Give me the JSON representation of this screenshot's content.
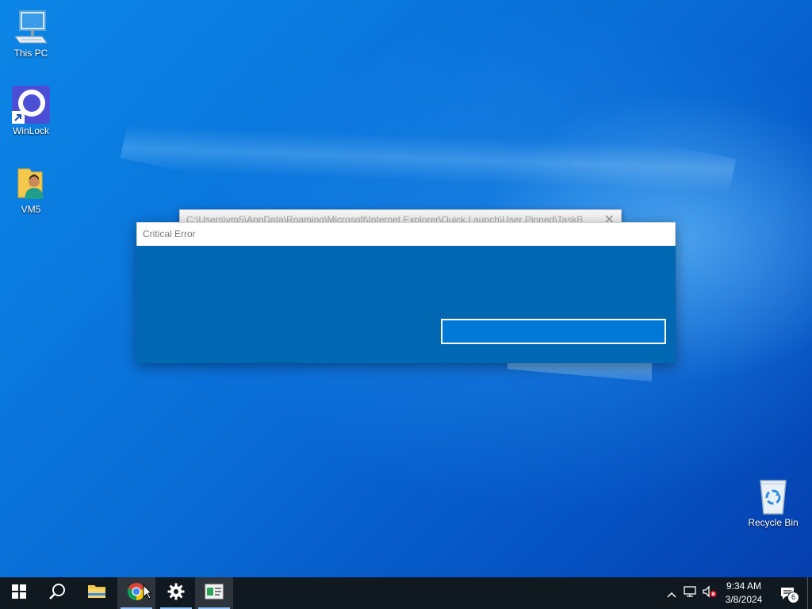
{
  "desktop": {
    "icons": [
      {
        "label": "This PC",
        "icon": "computer-icon"
      },
      {
        "label": "WinLock",
        "icon": "winlock-icon"
      },
      {
        "label": "VM5",
        "icon": "user-folder-icon"
      },
      {
        "label": "Recycle Bin",
        "icon": "recycle-bin-icon"
      }
    ]
  },
  "background_window": {
    "path": "C:\\Users\\vm5\\AppData\\Roaming\\Microsoft\\Internet Explorer\\Quick Launch\\User Pinned\\TaskB",
    "close_glyph": "✕"
  },
  "dialog": {
    "title": "Critical Error",
    "input_value": "",
    "colors": {
      "body": "#0067b3",
      "input_border": "#ffffff"
    }
  },
  "taskbar": {
    "items": [
      {
        "name": "start",
        "icon": "windows-logo-icon"
      },
      {
        "name": "search",
        "icon": "search-icon"
      },
      {
        "name": "file-explorer",
        "icon": "folder-icon"
      },
      {
        "name": "chrome",
        "icon": "chrome-icon"
      },
      {
        "name": "settings",
        "icon": "gear-icon"
      },
      {
        "name": "app-window",
        "icon": "app-window-icon",
        "active": true
      }
    ],
    "tray": {
      "time": "9:34 AM",
      "date": "3/8/2024",
      "notification_count": "6"
    }
  }
}
